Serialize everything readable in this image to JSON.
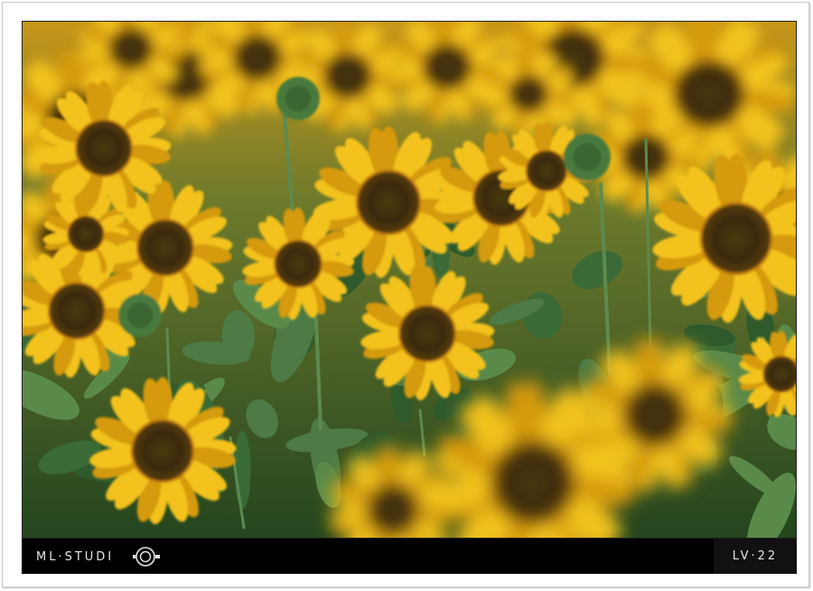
{
  "frame": {
    "brand": "ML·STUDI",
    "brand_logo": "camera-lens-o-icon",
    "level": "LV·22"
  },
  "photo": {
    "subject": "sunflower-field",
    "colors": {
      "petal": "#f3c21a",
      "petal_dark": "#d59a0a",
      "center": "#3a2a0e",
      "leaf": "#2f5a2c",
      "leaf_light": "#4d7a45",
      "sky_blur": "#e8b418"
    }
  }
}
